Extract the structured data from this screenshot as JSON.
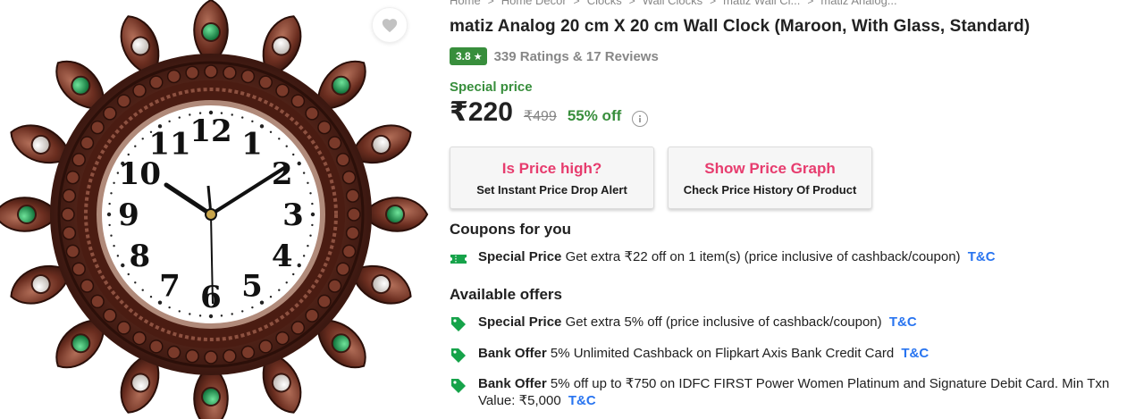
{
  "breadcrumb": [
    "Home",
    "Home Decor",
    "Clocks",
    "Wall Clocks",
    "matiz Wall Cl...",
    "matiz Analog..."
  ],
  "product": {
    "title": "matiz Analog 20 cm X 20 cm Wall Clock  (Maroon, With Glass, Standard)",
    "rating": "3.8",
    "rating_star": "★",
    "ratings_reviews": "339 Ratings & 17 Reviews"
  },
  "price": {
    "label": "Special price",
    "current": "₹220",
    "mrp": "₹499",
    "discount": "55% off"
  },
  "alert_buttons": {
    "price_high_title": "Is Price high?",
    "price_high_sub": "Set Instant Price Drop Alert",
    "graph_title": "Show Price Graph",
    "graph_sub": "Check Price History Of Product"
  },
  "coupons": {
    "title": "Coupons for you",
    "items": [
      {
        "kind": "Special Price",
        "desc": "Get extra ₹22 off on 1 item(s) (price inclusive of cashback/coupon)",
        "tc": "T&C"
      }
    ]
  },
  "offers": {
    "title": "Available offers",
    "items": [
      {
        "kind": "Special Price",
        "desc": "Get extra 5% off (price inclusive of cashback/coupon)",
        "tc": "T&C"
      },
      {
        "kind": "Bank Offer",
        "desc": "5% Unlimited Cashback on Flipkart Axis Bank Credit Card",
        "tc": "T&C"
      },
      {
        "kind": "Bank Offer",
        "desc": "5% off up to ₹750 on IDFC FIRST Power Women Platinum and Signature Debit Card. Min Txn",
        "desc2": "Value: ₹5,000",
        "tc": "T&C"
      }
    ]
  },
  "clock_numerals": [
    "12",
    "1",
    "2",
    "3",
    "4",
    "5",
    "6",
    "7",
    "8",
    "9",
    "10",
    "11"
  ],
  "icons": {
    "wishlist": "heart-icon",
    "info": "info-icon",
    "coupon": "coupon-ticket-icon",
    "offer": "offer-tag-icon"
  },
  "colors": {
    "offer_green": "#388e3c",
    "link_blue": "#2874f0",
    "alert_pink": "#e73c6e",
    "clock_maroon": "#5a2418"
  }
}
